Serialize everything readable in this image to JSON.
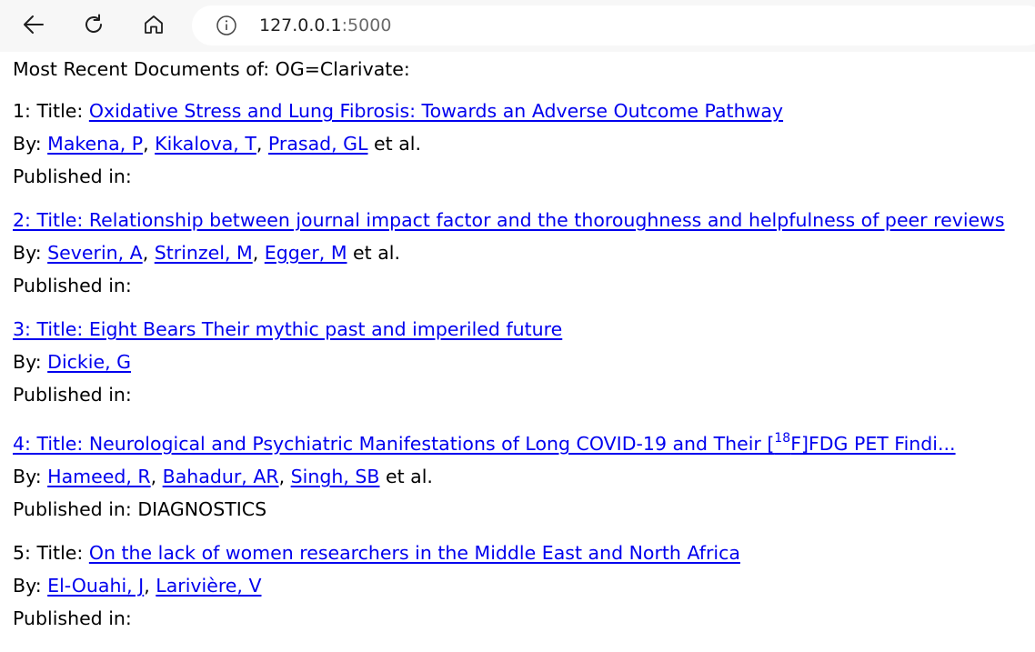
{
  "browser": {
    "url_host": "127.0.0.1",
    "url_port": ":5000"
  },
  "page": {
    "heading": "Most Recent Documents of: OG=Clarivate:",
    "by_label": "By:",
    "published_label": "Published in:",
    "et_al": "et al.",
    "documents": [
      {
        "prefix": "1: Title:",
        "title": "Oxidative Stress and Lung Fibrosis: Towards an Adverse Outcome Pathway",
        "authors": [
          "Makena, P",
          "Kikalova, T",
          "Prasad, GL"
        ],
        "et_al": true,
        "published_in": ""
      },
      {
        "link_text": "2: Title: Relationship between journal impact factor and the thoroughness and helpfulness of peer reviews",
        "authors": [
          "Severin, A",
          "Strinzel, M",
          "Egger, M"
        ],
        "et_al": true,
        "published_in": ""
      },
      {
        "link_text": "3: Title: Eight Bears Their mythic past and imperiled future",
        "authors": [
          "Dickie, G"
        ],
        "et_al": false,
        "published_in": ""
      },
      {
        "link_text_before_sup": "4: Title: Neurological and Psychiatric Manifestations of Long COVID-19 and Their [",
        "link_sup": "18",
        "link_text_after_sup": "F]FDG PET Findi...",
        "authors": [
          "Hameed, R",
          "Bahadur, AR",
          "Singh, SB"
        ],
        "et_al": true,
        "published_in": "DIAGNOSTICS"
      },
      {
        "prefix": "5: Title:",
        "title": "On the lack of women researchers in the Middle East and North Africa",
        "authors": [
          "El-Ouahi, J",
          "Larivière, V"
        ],
        "et_al": false,
        "published_in": ""
      }
    ]
  },
  "icons": [
    "back-arrow-icon",
    "reload-icon",
    "home-icon",
    "info-icon"
  ]
}
